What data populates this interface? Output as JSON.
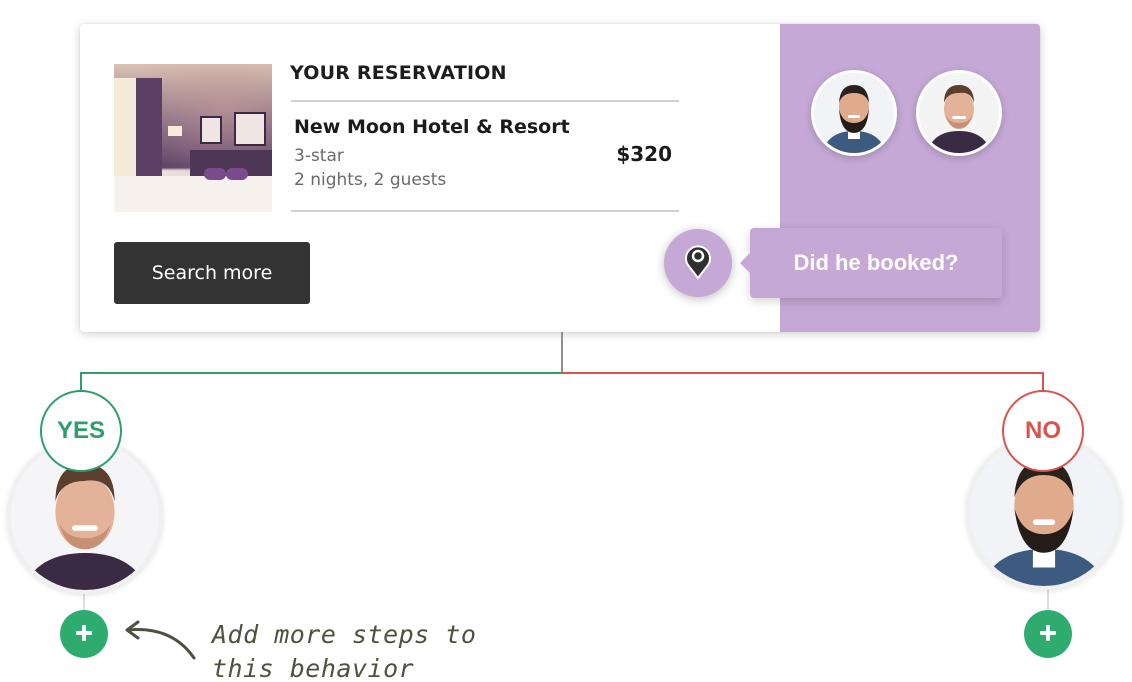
{
  "reservation": {
    "title": "YOUR RESERVATION",
    "hotel_name": "New Moon Hotel & Resort",
    "rating": "3-star",
    "stay": "2 nights, 2 guests",
    "price": "$320",
    "search_button": "Search more",
    "photo": "hotel-room-photo"
  },
  "audience": {
    "avatars": [
      "bearded-man-avatar",
      "smiling-man-avatar"
    ]
  },
  "condition": {
    "icon": "map-pin-icon",
    "question": "Did he booked?"
  },
  "branches": {
    "yes": {
      "label": "YES",
      "avatar": "smiling-man-avatar",
      "color": "#2e9e6b"
    },
    "no": {
      "label": "NO",
      "avatar": "bearded-man-avatar",
      "color": "#d9534f"
    }
  },
  "annotation": {
    "line1": "Add more steps to",
    "line2": "this behavior"
  },
  "colors": {
    "accent_purple": "#c5a8d6",
    "button_dark": "#333333",
    "add_green": "#2eab6e"
  }
}
